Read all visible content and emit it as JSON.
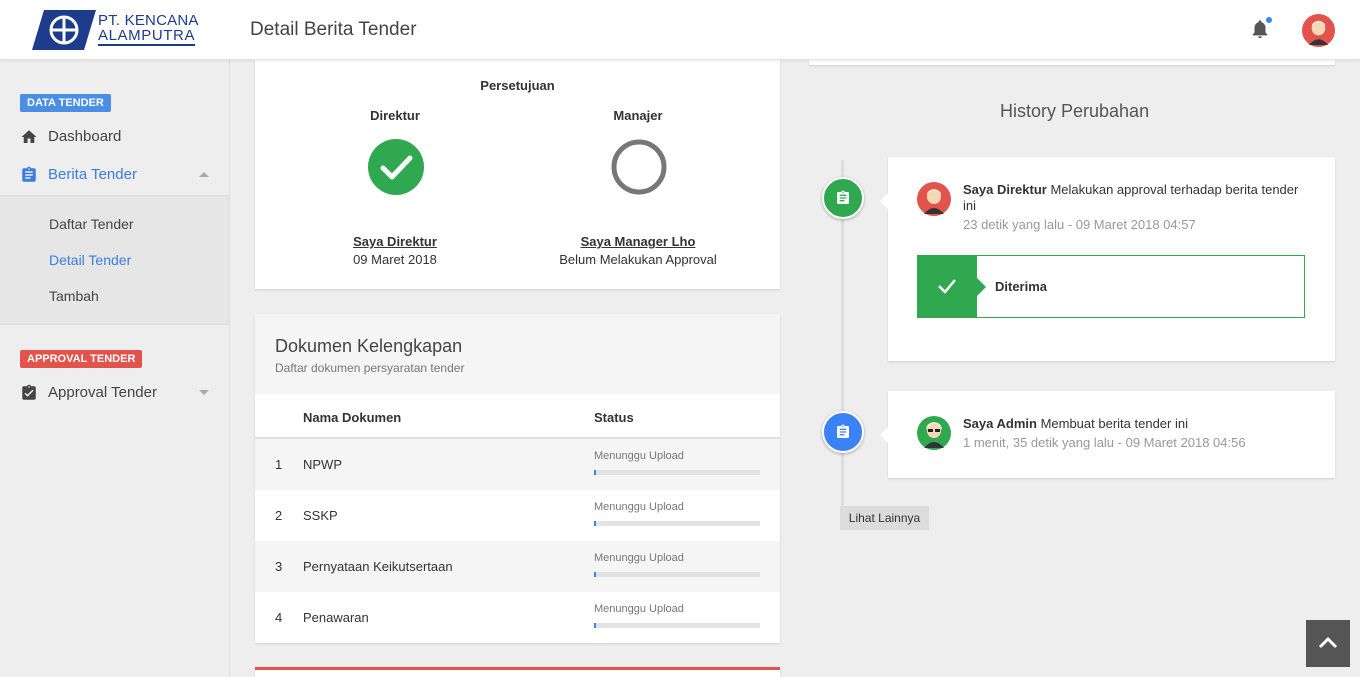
{
  "header": {
    "company_line1": "PT. KENCANA",
    "company_line2": "ALAMPUTRA",
    "page_title": "Detail Berita Tender"
  },
  "sidebar": {
    "section1_badge": "DATA TENDER",
    "dashboard_label": "Dashboard",
    "berita_tender_label": "Berita Tender",
    "submenu": [
      "Daftar Tender",
      "Detail Tender",
      "Tambah"
    ],
    "section2_badge": "APPROVAL TENDER",
    "approval_label": "Approval Tender"
  },
  "approval": {
    "title": "Persetujuan",
    "direktur": {
      "role": "Direktur",
      "name": "Saya Direktur",
      "status": "09 Maret 2018"
    },
    "manajer": {
      "role": "Manajer",
      "name": "Saya Manager Lho",
      "status": "Belum Melakukan Approval"
    }
  },
  "documents": {
    "title": "Dokumen Kelengkapan",
    "subtitle": "Daftar dokumen persyaratan tender",
    "col_name": "Nama Dokumen",
    "col_status": "Status",
    "rows": [
      {
        "no": "1",
        "name": "NPWP",
        "status": "Menunggu Upload",
        "progress": 0.01
      },
      {
        "no": "2",
        "name": "SSKP",
        "status": "Menunggu Upload",
        "progress": 0.01
      },
      {
        "no": "3",
        "name": "Pernyataan Keikutsertaan",
        "status": "Menunggu Upload",
        "progress": 0.01
      },
      {
        "no": "4",
        "name": "Penawaran",
        "status": "Menunggu Upload",
        "progress": 0.01
      }
    ]
  },
  "history": {
    "title": "History Perubahan",
    "entries": [
      {
        "actor": "Saya Direktur",
        "action": "Melakukan approval terhadap berita tender ini",
        "time": "23 detik yang lalu - 09 Maret 2018 04:57",
        "status_label": "Diterima"
      },
      {
        "actor": "Saya Admin",
        "action": "Membuat berita tender ini",
        "time": "1 menit, 35 detik yang lalu - 09 Maret 2018 04:56"
      }
    ],
    "more_label": "Lihat Lainnya"
  },
  "colors": {
    "accent_blue": "#3a7de0",
    "success_green": "#2fa84f",
    "danger_red": "#e2534b"
  }
}
